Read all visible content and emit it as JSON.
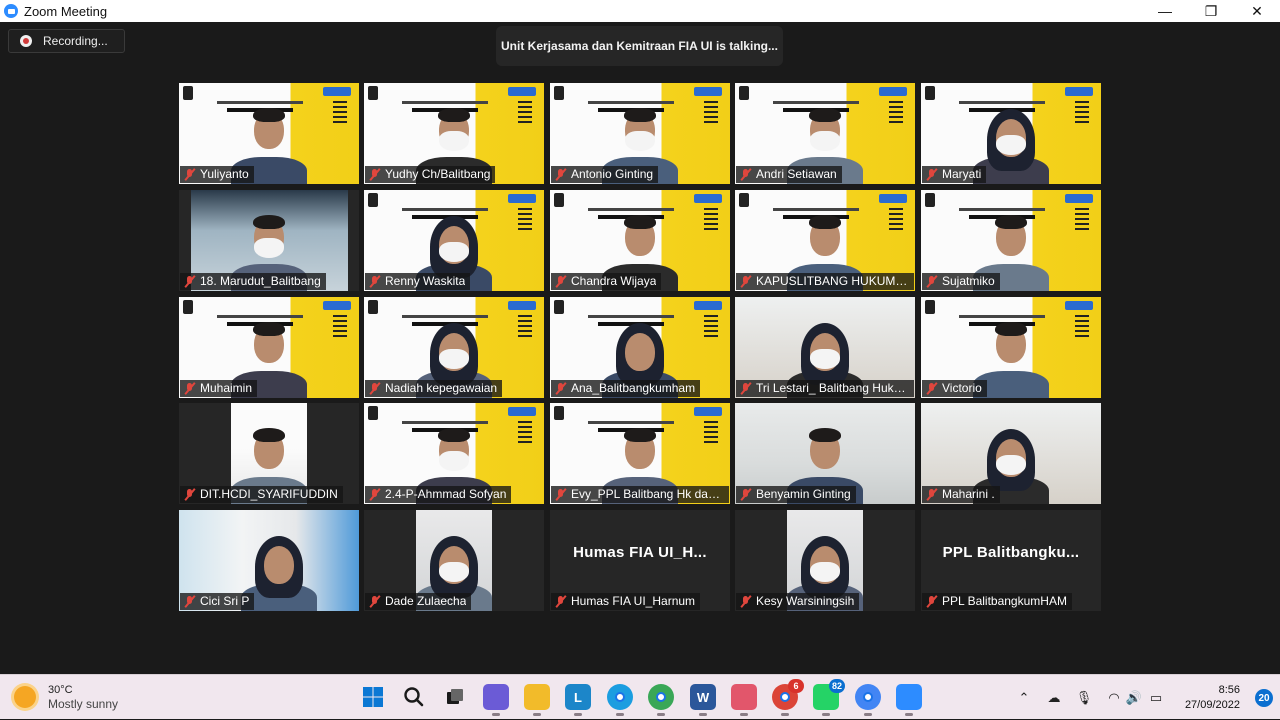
{
  "window": {
    "title": "Zoom Meeting",
    "minimize": "—",
    "restore": "❐",
    "close": "✕"
  },
  "recording": {
    "label": "Recording..."
  },
  "talking": {
    "text": "Unit Kerjasama dan Kemitraan FIA UI is talking..."
  },
  "participants": [
    {
      "name": "Yuliyanto",
      "type": "slide"
    },
    {
      "name": "Yudhy Ch/Balitbang",
      "type": "slide"
    },
    {
      "name": "Antonio Ginting",
      "type": "slide"
    },
    {
      "name": "Andri Setiawan",
      "type": "slide"
    },
    {
      "name": "Maryati",
      "type": "slide"
    },
    {
      "name": "18. Marudut_Balitbang",
      "type": "pip"
    },
    {
      "name": "Renny Waskita",
      "type": "slide"
    },
    {
      "name": "Chandra Wijaya",
      "type": "slide"
    },
    {
      "name": "KAPUSLITBANG HUKUM- J...",
      "type": "slide"
    },
    {
      "name": "Sujatmiko",
      "type": "slide"
    },
    {
      "name": "Muhaimin",
      "type": "slide"
    },
    {
      "name": "Nadiah kepegawaian",
      "type": "slide"
    },
    {
      "name": "Ana_Balitbangkumham",
      "type": "slide"
    },
    {
      "name": "Tri Lestari_ Balitbang Huku...",
      "type": "room"
    },
    {
      "name": "Victorio",
      "type": "slide"
    },
    {
      "name": "DIT.HCDI_SYARIFUDDIN",
      "type": "pip"
    },
    {
      "name": "2.4-P-Ahmmad Sofyan",
      "type": "slide"
    },
    {
      "name": "Evy_PPL Balitbang Hk dan ...",
      "type": "slide"
    },
    {
      "name": "Benyamin Ginting",
      "type": "room"
    },
    {
      "name": "Maharini .",
      "type": "room"
    },
    {
      "name": "Cici Sri P",
      "type": "room"
    },
    {
      "name": "Dade Zulaecha",
      "type": "pip"
    },
    {
      "name": "Humas FIA UI_Harnum",
      "type": "name",
      "card": "Humas FIA UI_H..."
    },
    {
      "name": "Kesy Warsiningsih",
      "type": "pip"
    },
    {
      "name": "PPL BalitbangkumHAM",
      "type": "name",
      "card": "PPL  Balitbangku..."
    }
  ],
  "taskbar": {
    "weather": {
      "temp": "30°C",
      "condition": "Mostly sunny"
    },
    "apps": [
      {
        "name": "windows-start-icon",
        "glyph": "",
        "color": "#0b6fd0"
      },
      {
        "name": "search-icon",
        "glyph": "",
        "color": "transparent"
      },
      {
        "name": "task-view-icon",
        "glyph": "",
        "color": "transparent"
      },
      {
        "name": "chat-icon",
        "glyph": "",
        "color": "#6b5bd6"
      },
      {
        "name": "file-explorer-icon",
        "glyph": "",
        "color": "#f2bb2a"
      },
      {
        "name": "l-app-icon",
        "glyph": "L",
        "color": "#1c86c9"
      },
      {
        "name": "edge-icon",
        "glyph": "",
        "color": "#1b9de0"
      },
      {
        "name": "chrome-profile-icon",
        "glyph": "",
        "color": "#3aa757"
      },
      {
        "name": "word-icon",
        "glyph": "W",
        "color": "#2b579a"
      },
      {
        "name": "snipping-tool-icon",
        "glyph": "",
        "color": "#e2566b"
      },
      {
        "name": "chrome-icon",
        "glyph": "",
        "color": "#db4437",
        "badge": "6",
        "badge_color": "red"
      },
      {
        "name": "whatsapp-icon",
        "glyph": "",
        "color": "#25d366",
        "badge": "82"
      },
      {
        "name": "chrome-alt-icon",
        "glyph": "",
        "color": "#4285f4"
      },
      {
        "name": "zoom-icon",
        "glyph": "",
        "color": "#2d8cff"
      }
    ],
    "clock": {
      "time": "8:56",
      "date": "27/09/2022"
    },
    "notifications": "20"
  }
}
